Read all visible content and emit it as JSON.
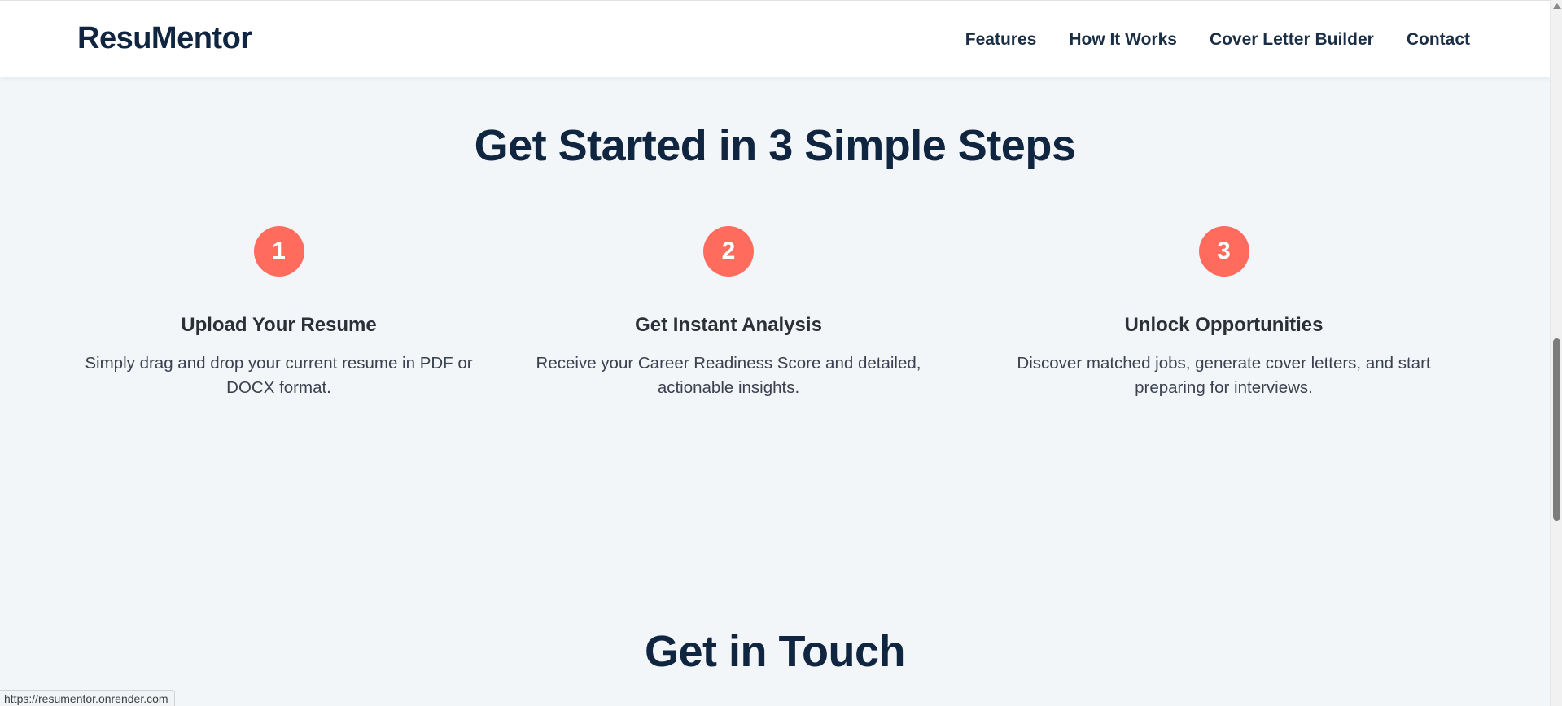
{
  "header": {
    "logo": "ResuMentor",
    "nav": [
      "Features",
      "How It Works",
      "Cover Letter Builder",
      "Contact"
    ]
  },
  "how_it_works": {
    "title": "Get Started in 3 Simple Steps",
    "steps": [
      {
        "number": "1",
        "title": "Upload Your Resume",
        "description": "Simply drag and drop your current resume in PDF or DOCX format."
      },
      {
        "number": "2",
        "title": "Get Instant Analysis",
        "description": "Receive your Career Readiness Score and detailed, actionable insights."
      },
      {
        "number": "3",
        "title": "Unlock Opportunities",
        "description": "Discover matched jobs, generate cover letters, and start preparing for interviews."
      }
    ]
  },
  "contact": {
    "title": "Get in Touch"
  },
  "status_bar": {
    "url": "https://resumentor.onrender.com"
  },
  "colors": {
    "brand_navy": "#0f2540",
    "accent_coral": "#ff6b5d",
    "page_background": "#f3f6f9",
    "header_background": "#ffffff"
  }
}
